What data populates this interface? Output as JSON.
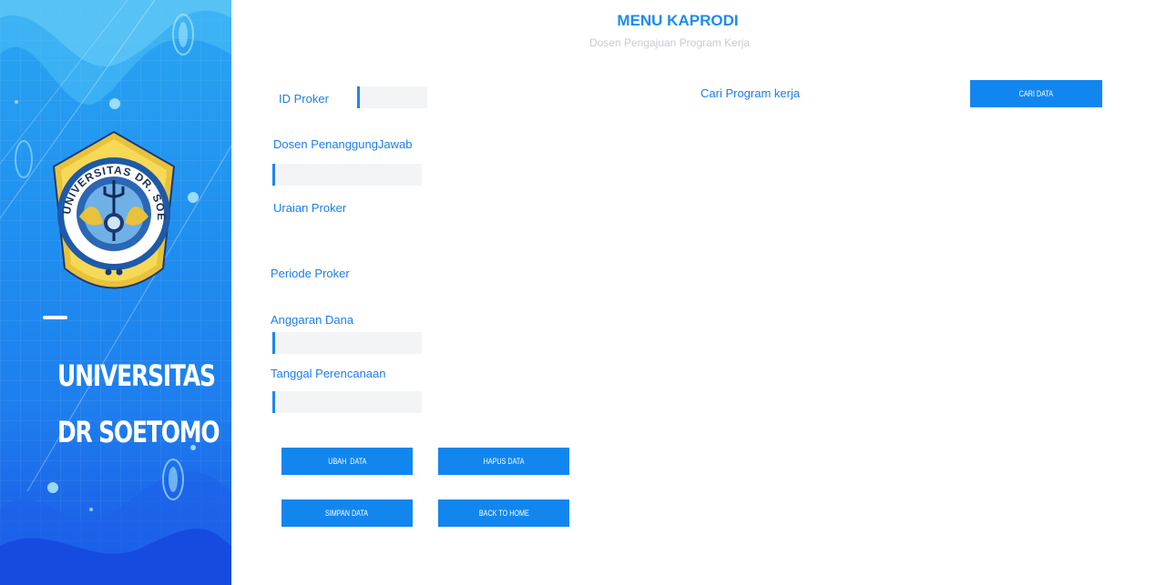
{
  "sidebar": {
    "uni_line1": "UNIVERSITAS",
    "uni_line2": "DR SOETOMO",
    "logo": {
      "ring_text": "UNIVERSITAS DR. SOETOMO",
      "icon": "university-seal-icon"
    }
  },
  "header": {
    "title": "MENU KAPRODI",
    "subtitle": "Dosen Pengajuan Program Kerja"
  },
  "form": {
    "id_proker": {
      "label": "ID Proker",
      "value": ""
    },
    "dosen": {
      "label": "Dosen PenanggungJawab",
      "value": ""
    },
    "uraian": {
      "label": "Uraian Proker"
    },
    "periode": {
      "label": "Periode Proker"
    },
    "anggaran": {
      "label": "Anggaran Dana",
      "value": ""
    },
    "tanggal": {
      "label": "Tanggal Perencanaan",
      "value": ""
    }
  },
  "search": {
    "label": "Cari Program kerja",
    "button": "CARI DATA"
  },
  "actions": {
    "ubah": "UBAH  DATA",
    "hapus": "HAPUS DATA",
    "simpan": "SIMPAN DATA",
    "back": "BACK TO HOME"
  },
  "colors": {
    "accent": "#1286ef",
    "label": "#1d7cee",
    "sidebar_top": "#2aa6f2",
    "sidebar_bottom": "#1a55e6"
  }
}
